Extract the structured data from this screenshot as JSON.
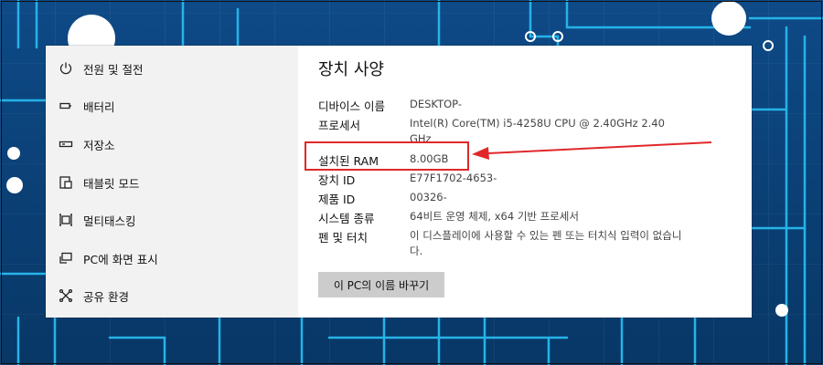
{
  "sidebar": {
    "items": [
      {
        "label": "전원 및 절전",
        "icon": "power-icon"
      },
      {
        "label": "배터리",
        "icon": "battery-icon"
      },
      {
        "label": "저장소",
        "icon": "storage-icon"
      },
      {
        "label": "태블릿 모드",
        "icon": "tablet-mode-icon"
      },
      {
        "label": "멀티태스킹",
        "icon": "multitasking-icon"
      },
      {
        "label": "PC에 화면 표시",
        "icon": "project-to-pc-icon"
      },
      {
        "label": "공유 환경",
        "icon": "shared-experiences-icon"
      }
    ]
  },
  "specs": {
    "title": "장치 사양",
    "device_name": {
      "label": "디바이스 이름",
      "value": "DESKTOP-"
    },
    "processor": {
      "label": "프로세서",
      "value": "Intel(R) Core(TM) i5-4258U CPU @ 2.40GHz   2.40 GHz"
    },
    "ram": {
      "label": "설치된 RAM",
      "value": "8.00GB"
    },
    "device_id": {
      "label": "장치 ID",
      "value": "E77F1702-4653-"
    },
    "product_id": {
      "label": "제품 ID",
      "value": "00326-"
    },
    "system_type": {
      "label": "시스템 종류",
      "value": "64비트 운영 체제, x64 기반 프로세서"
    },
    "pen_touch": {
      "label": "펜 및 터치",
      "value": "이 디스플레이에 사용할 수 있는 펜 또는 터치식 입력이 없습니다."
    },
    "rename_button": "이 PC의 이름 바꾸기"
  },
  "colors": {
    "background": "#0a3f78",
    "sidebar": "#f2f2f2",
    "button": "#cccccc",
    "highlight": "#e0282a"
  }
}
